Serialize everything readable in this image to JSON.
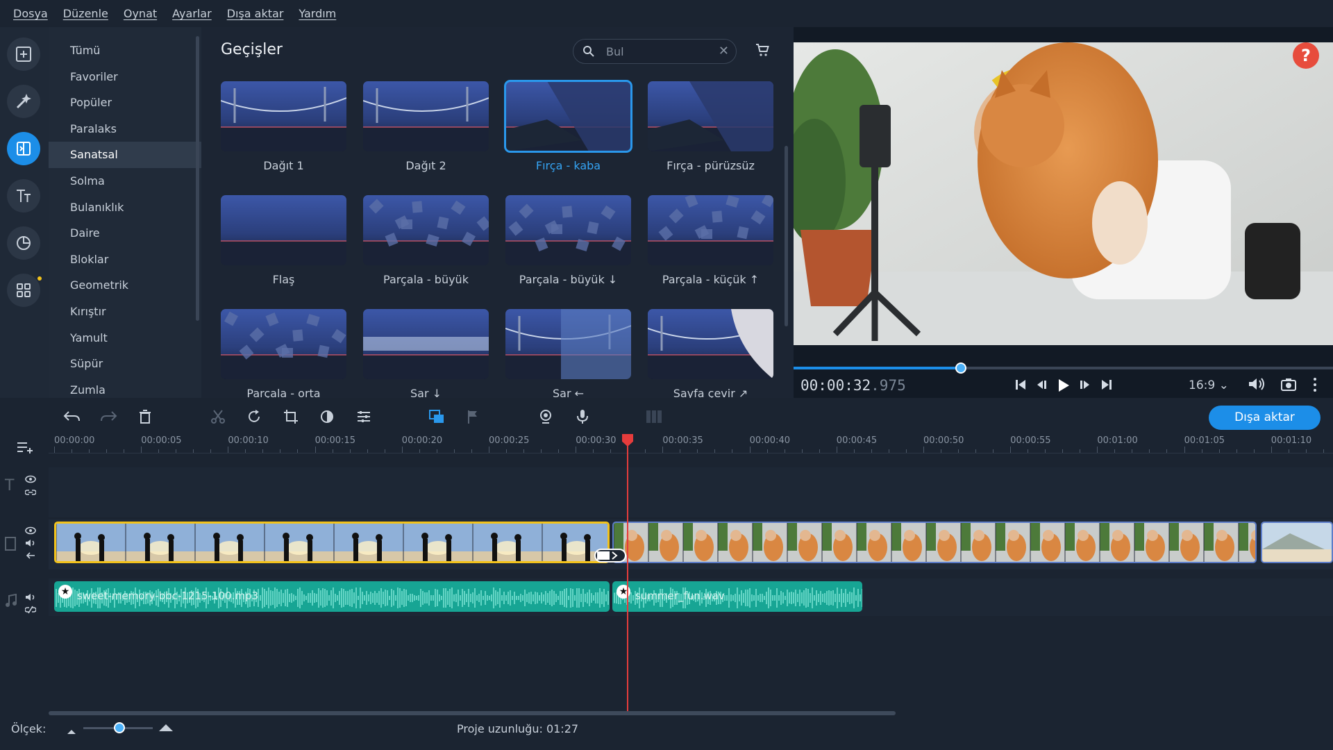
{
  "menu": [
    "Dosya",
    "Düzenle",
    "Oynat",
    "Ayarlar",
    "Dışa aktar",
    "Yardım"
  ],
  "tools": [
    {
      "name": "import-icon",
      "active": false
    },
    {
      "name": "magic-icon",
      "active": false
    },
    {
      "name": "transitions-icon",
      "active": true
    },
    {
      "name": "titles-icon",
      "active": false
    },
    {
      "name": "stickers-icon",
      "active": false
    },
    {
      "name": "more-tools-icon",
      "active": false
    }
  ],
  "categories": [
    "Tümü",
    "Favoriler",
    "Popüler",
    "Paralaks",
    "Sanatsal",
    "Solma",
    "Bulanıklık",
    "Daire",
    "Bloklar",
    "Geometrik",
    "Kırıştır",
    "Yamult",
    "Süpür",
    "Zumla"
  ],
  "selected_category": "Sanatsal",
  "browser": {
    "title": "Geçişler",
    "search_placeholder": "Bul",
    "tiles": [
      "Dağıt 1",
      "Dağıt 2",
      "Fırça - kaba",
      "Fırça - pürüzsüz",
      "Flaş",
      "Parçala - büyük",
      "Parçala - büyük ↓",
      "Parçala - küçük ↑",
      "Parçala - orta",
      "Sar ↓",
      "Sar ←",
      "Sayfa çevir ↗"
    ],
    "selected_tile": "Fırça - kaba"
  },
  "player": {
    "timecode_main": "00:00:32",
    "timecode_ms": ".975",
    "aspect": "16:9",
    "progress": 0.31,
    "help": "?"
  },
  "toolbar": {
    "export_label": "Dışa aktar"
  },
  "ruler": [
    "00:00:00",
    "00:00:05",
    "00:00:10",
    "00:00:15",
    "00:00:20",
    "00:00:25",
    "00:00:30",
    "00:00:35",
    "00:00:40",
    "00:00:45",
    "00:00:50",
    "00:00:55",
    "00:01:00",
    "00:01:05",
    "00:01:10"
  ],
  "audio": [
    {
      "label": "sweet-memory-bbc-1215-100.mp3"
    },
    {
      "label": "summer_fun.wav"
    }
  ],
  "status": {
    "scale_label": "Ölçek:",
    "project_length": "Proje uzunluğu: 01:27",
    "zoom": 0.52
  },
  "colors": {
    "accent": "#1c8ee8",
    "selected_clip": "#f2c21b",
    "audio": "#17a594",
    "playhead": "#e63c3c"
  }
}
